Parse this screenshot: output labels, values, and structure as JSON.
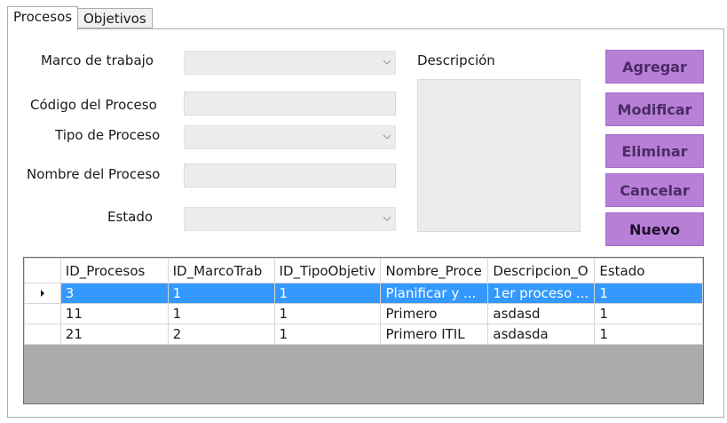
{
  "tabs": [
    {
      "label": "Procesos",
      "active": true
    },
    {
      "label": "Objetivos",
      "active": false
    }
  ],
  "form": {
    "marco_label": "Marco de trabajo",
    "codigo_label": "Código del Proceso",
    "tipo_label": "Tipo de Proceso",
    "nombre_label": "Nombre del Proceso",
    "estado_label": "Estado",
    "descripcion_label": "Descripción"
  },
  "buttons": {
    "agregar": "Agregar",
    "modificar": "Modificar",
    "eliminar": "Eliminar",
    "cancelar": "Cancelar",
    "nuevo": "Nuevo"
  },
  "grid": {
    "columns": [
      "ID_Procesos",
      "ID_MarcoTrab",
      "ID_TipoObjetiv",
      "Nombre_Proce",
      "Descripcion_O",
      "Estado"
    ],
    "rows": [
      {
        "cells": [
          "3",
          "1",
          "1",
          "Planificar y ...",
          "1er proceso ...",
          "1"
        ],
        "selected": true
      },
      {
        "cells": [
          "11",
          "1",
          "1",
          "Primero",
          "asdasd",
          "1"
        ],
        "selected": false
      },
      {
        "cells": [
          "21",
          "2",
          "1",
          "Primero ITIL",
          "asdasda",
          "1"
        ],
        "selected": false
      }
    ]
  },
  "colors": {
    "button_bg": "#b87fd7",
    "selection": "#3399ff",
    "grid_empty": "#ababab"
  },
  "icons": {
    "combo_arrow": "chevron-down-icon",
    "current_row": "row-indicator-icon"
  }
}
